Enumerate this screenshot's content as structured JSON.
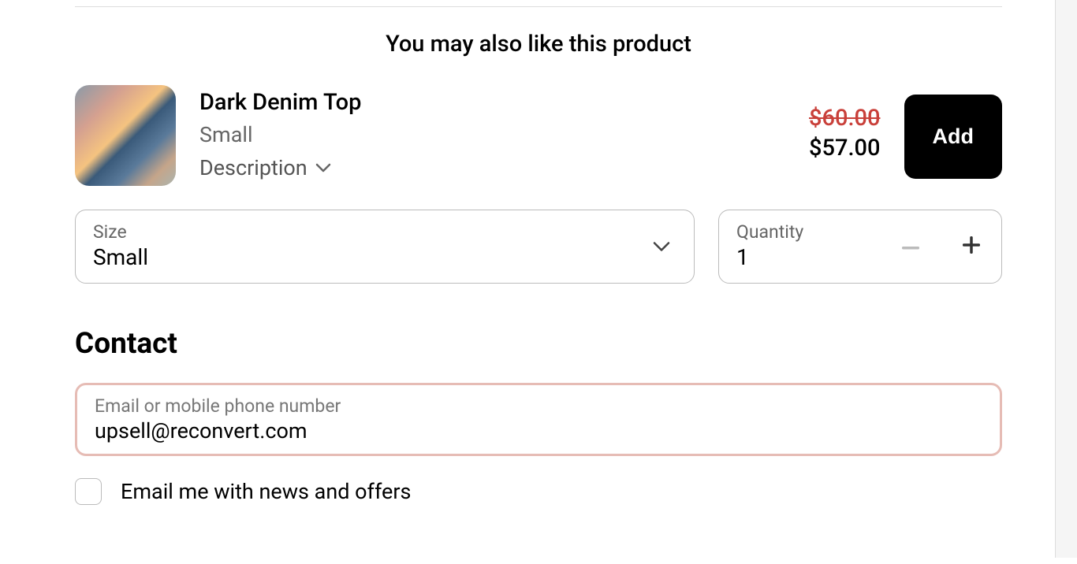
{
  "upsell": {
    "heading": "You may also like this product",
    "product": {
      "title": "Dark Denim Top",
      "variant": "Small",
      "descriptionLabel": "Description",
      "comparePrice": "$60.00",
      "salePrice": "$57.00",
      "addLabel": "Add"
    },
    "size": {
      "label": "Size",
      "value": "Small"
    },
    "quantity": {
      "label": "Quantity",
      "value": "1"
    }
  },
  "contact": {
    "heading": "Contact",
    "field": {
      "label": "Email or mobile phone number",
      "value": "upsell@reconvert.com"
    },
    "newsletterLabel": "Email me with news and offers"
  }
}
